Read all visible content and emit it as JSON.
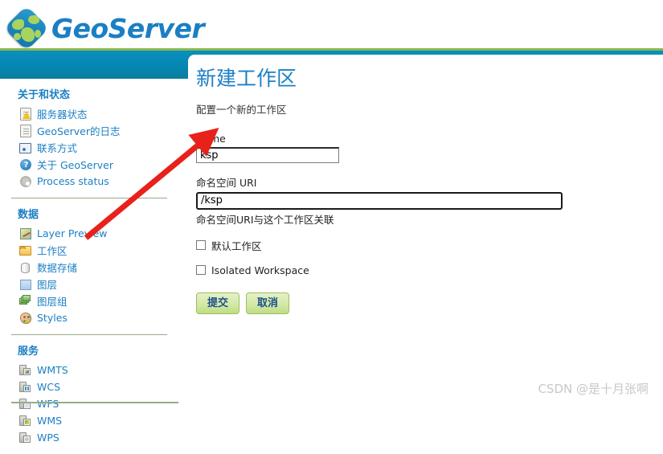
{
  "header": {
    "logo_text": "GeoServer",
    "logo_icon": "globe-icon"
  },
  "sidebar": {
    "groups": [
      {
        "title": "关于和状态",
        "items": [
          {
            "label": "服务器状态",
            "icon": "server-status-icon"
          },
          {
            "label": "GeoServer的日志",
            "icon": "log-page-icon"
          },
          {
            "label": "联系方式",
            "icon": "contact-card-icon"
          },
          {
            "label": "关于 GeoServer",
            "icon": "help-circle-icon"
          },
          {
            "label": "Process status",
            "icon": "gear-icon"
          }
        ]
      },
      {
        "title": "数据",
        "items": [
          {
            "label": "Layer Preview",
            "icon": "map-preview-icon"
          },
          {
            "label": "工作区",
            "icon": "folder-icon"
          },
          {
            "label": "数据存储",
            "icon": "database-cylinder-icon"
          },
          {
            "label": "图层",
            "icon": "layer-square-icon"
          },
          {
            "label": "图层组",
            "icon": "layer-group-icon"
          },
          {
            "label": "Styles",
            "icon": "palette-icon"
          }
        ]
      },
      {
        "title": "服务",
        "items": [
          {
            "label": "WMTS",
            "icon": "service-wmts-icon"
          },
          {
            "label": "WCS",
            "icon": "service-wcs-icon"
          },
          {
            "label": "WFS",
            "icon": "service-wfs-icon"
          },
          {
            "label": "WMS",
            "icon": "service-wms-icon"
          },
          {
            "label": "WPS",
            "icon": "service-wps-icon"
          }
        ]
      }
    ]
  },
  "main": {
    "title": "新建工作区",
    "subtitle": "配置一个新的工作区",
    "name_field": {
      "label": "Name",
      "value": "ksp",
      "placeholder": ""
    },
    "uri_field": {
      "label": "命名空间 URI",
      "value": "/ksp",
      "placeholder": "",
      "hint": "命名空间URI与这个工作区关联"
    },
    "checkboxes": [
      {
        "label": "默认工作区",
        "checked": false
      },
      {
        "label": "Isolated Workspace",
        "checked": false
      }
    ],
    "submit_label": "提交",
    "cancel_label": "取消"
  },
  "annotation": {
    "arrow_color": "#e8211b",
    "arrow_name": "red-pointer-arrow"
  },
  "watermark": {
    "text": "CSDN @是十月张啊"
  },
  "colors": {
    "brand_blue": "#1b7fc4",
    "band_blue": "#0587b3",
    "accent_green": "#8ab84f",
    "button_green": "#d3e9a6"
  }
}
